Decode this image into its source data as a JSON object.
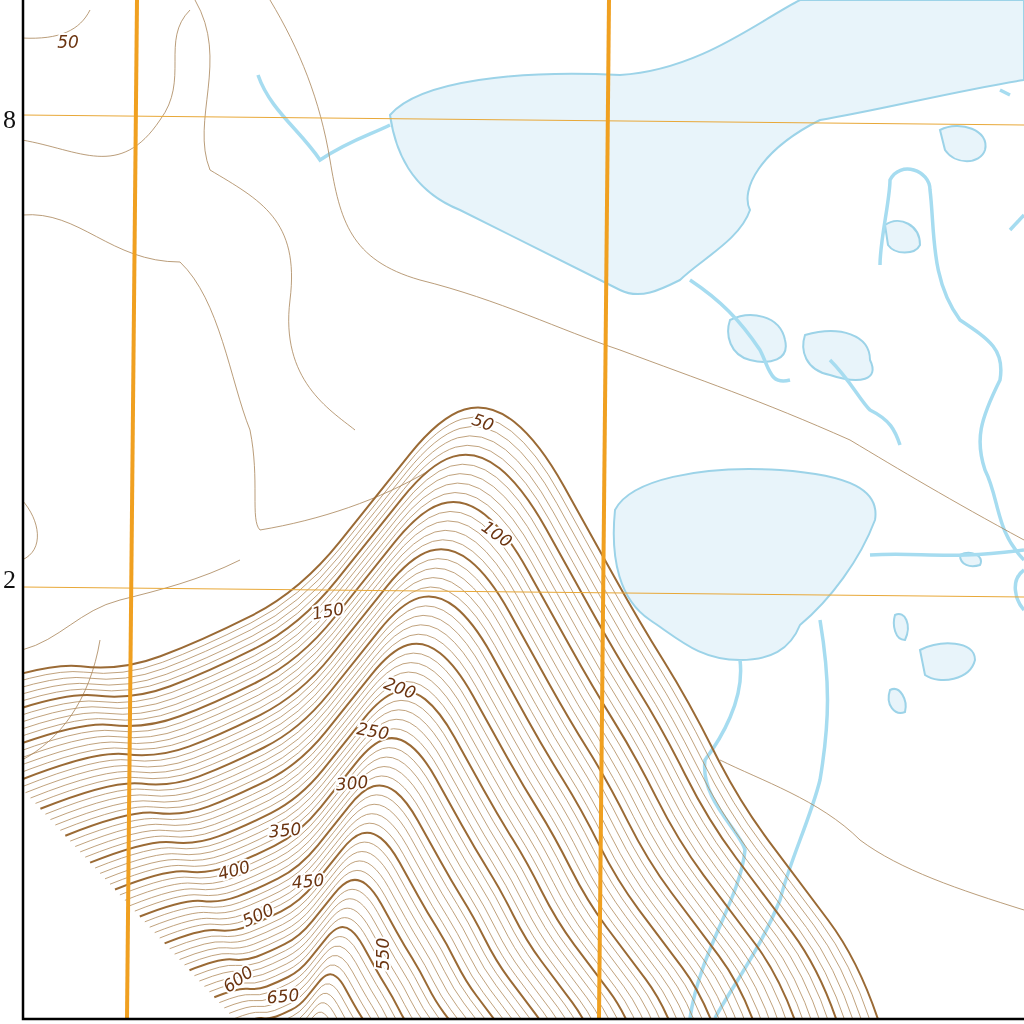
{
  "map": {
    "grid_labels": [
      {
        "text": "8"
      },
      {
        "text": "2"
      }
    ],
    "contour_labels": [
      "50",
      "50",
      "100",
      "150",
      "200",
      "250",
      "300",
      "350",
      "400",
      "450",
      "500",
      "550",
      "600",
      "650"
    ]
  }
}
